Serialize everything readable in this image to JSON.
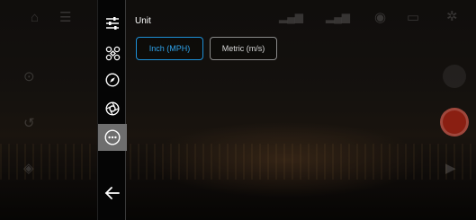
{
  "panel": {
    "title": "Unit",
    "options": [
      {
        "label": "Inch (MPH)",
        "selected": true
      },
      {
        "label": "Metric (m/s)",
        "selected": false
      }
    ]
  },
  "menu": {
    "items": [
      {
        "icon": "sliders-icon",
        "active": false
      },
      {
        "icon": "drone-icon",
        "active": false
      },
      {
        "icon": "compass-icon",
        "active": false
      },
      {
        "icon": "camera-aperture-icon",
        "active": false
      },
      {
        "icon": "more-icon",
        "active": true
      },
      {
        "icon": "back-arrow-icon",
        "active": false
      }
    ]
  },
  "colors": {
    "accent": "#1d8fd6",
    "active_menu_bg": "#6e6e6e",
    "record": "#8a1f12"
  }
}
